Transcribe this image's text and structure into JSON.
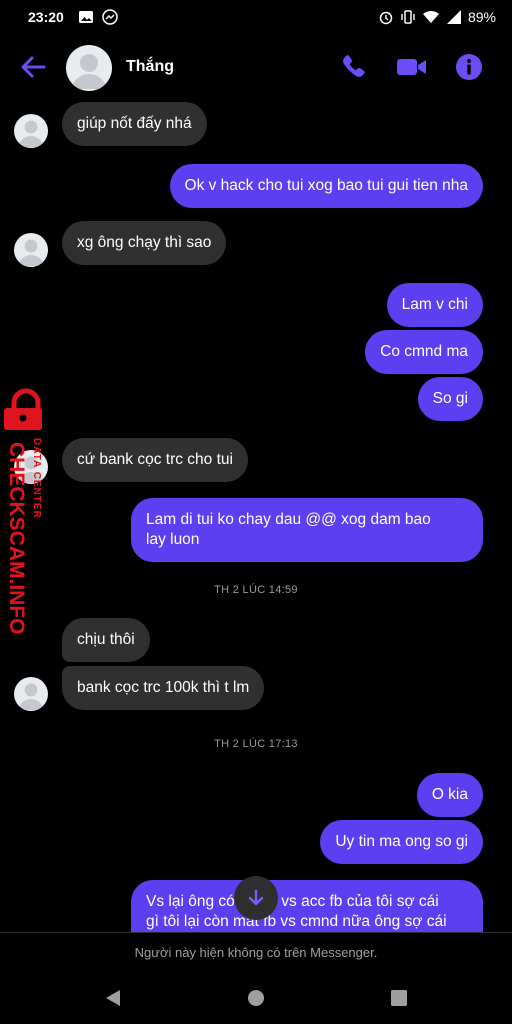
{
  "status_bar": {
    "time": "23:20",
    "battery": "89%"
  },
  "header": {
    "contact_name": "Thắng"
  },
  "messages": [
    {
      "dir": "in",
      "text": "giúp nốt đấy nhá"
    },
    {
      "dir": "out",
      "text": "Ok v hack cho tui xog bao tui gui tien nha"
    },
    {
      "dir": "in",
      "text": "xg ông chạy thì sao"
    },
    {
      "dir": "out",
      "text": "Lam v chi"
    },
    {
      "dir": "out",
      "text": "Co cmnd ma"
    },
    {
      "dir": "out",
      "text": "So gi"
    },
    {
      "dir": "in",
      "text": "cứ bank cọc trc cho tui"
    },
    {
      "dir": "out",
      "line1": "Lam di tui ko chay dau @@ xog dam bao",
      "line2": "lay luon"
    },
    {
      "dir": "in",
      "text": "chịu thôi"
    },
    {
      "dir": "in",
      "text": "bank cọc trc 100k thì t lm"
    },
    {
      "dir": "out",
      "text": "O kia"
    },
    {
      "dir": "out",
      "text": "Uy tin ma ong so gi"
    },
    {
      "dir": "out",
      "line1": "Vs lại ông có cmnd vs acc fb của tôi sợ cái",
      "line2": "gì tôi lại còn mất fb vs cmnd nữa ông sợ cái"
    }
  ],
  "timestamps": [
    "TH 2 LÚC 14:59",
    "TH 2 LÚC 17:13"
  ],
  "notice": "Người này hiện không có trên Messenger.",
  "watermark": {
    "brand": "CHECKSCAM.INFO",
    "sub": "DATA CENTER"
  },
  "colors": {
    "accent": "#5b3ff0",
    "incoming": "#303030",
    "background": "#000000",
    "watermark": "#e0141c"
  }
}
